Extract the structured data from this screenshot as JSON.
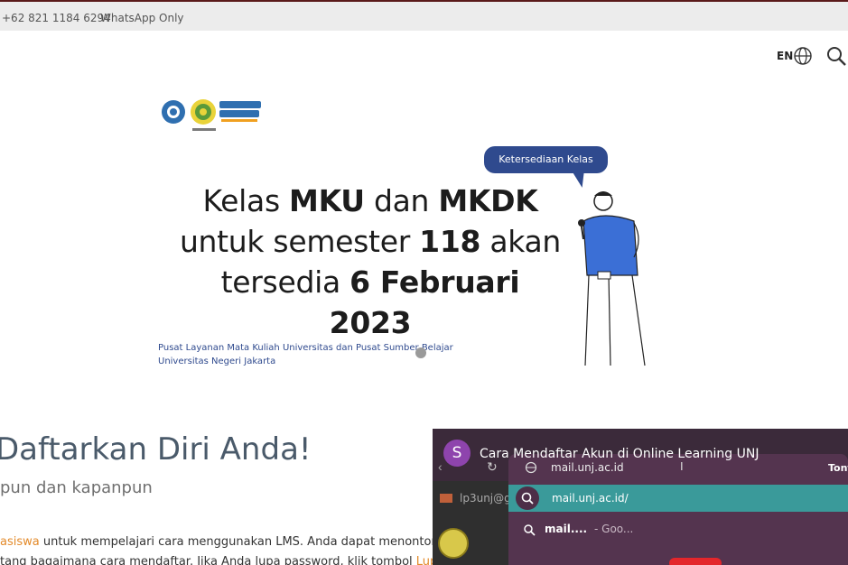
{
  "topbar": {
    "phone": "+62 821 1184 6294",
    "whatsapp": "WhatsApp Only"
  },
  "header": {
    "lang": "EN",
    "globe_icon": "globe-icon",
    "search_icon": "search-icon"
  },
  "banner": {
    "bubble": "Ketersediaan Kelas",
    "line1_a": "Kelas ",
    "line1_b": "MKU",
    "line1_c": " dan ",
    "line1_d": "MKDK",
    "line2_a": "untuk semester ",
    "line2_b": "118",
    "line2_c": " akan",
    "line3_a": "tersedia ",
    "line3_b": "6 Februari 2023",
    "credit_line1": "Pusat Layanan Mata Kuliah Universitas dan Pusat Sumber Belajar",
    "credit_line2": "Universitas Negeri Jakarta"
  },
  "content": {
    "heading": "Daftarkan Diri Anda!",
    "subheading": "pun dan kapanpun",
    "para1_orange": "asiswa",
    "para1_rest": " untuk mempelajari cara menggunakan LMS. Anda dapat menonton",
    "para2_rest": "tang bagaimana cara mendaftar. Jika Anda lupa password, klik tombol ",
    "para2_orange": "Lupa"
  },
  "video": {
    "avatar_letter": "S",
    "title": "Cara Mendaftar Akun di Online Learning UNJ",
    "omnibox_url": "mail.unj.ac.id",
    "omnibox_right": "Tont",
    "suggestion1": "mail.unj.ac.id/",
    "suggestion2_bold": "mail....",
    "suggestion2_rest": "- Goo...",
    "mail_sidebar": "lp3unj@g"
  },
  "colors": {
    "brand_blue": "#2f4a8e",
    "orange_link": "#e38a2a",
    "omni_bg": "#54344f",
    "suggestion_bg": "#3a9a9a"
  }
}
